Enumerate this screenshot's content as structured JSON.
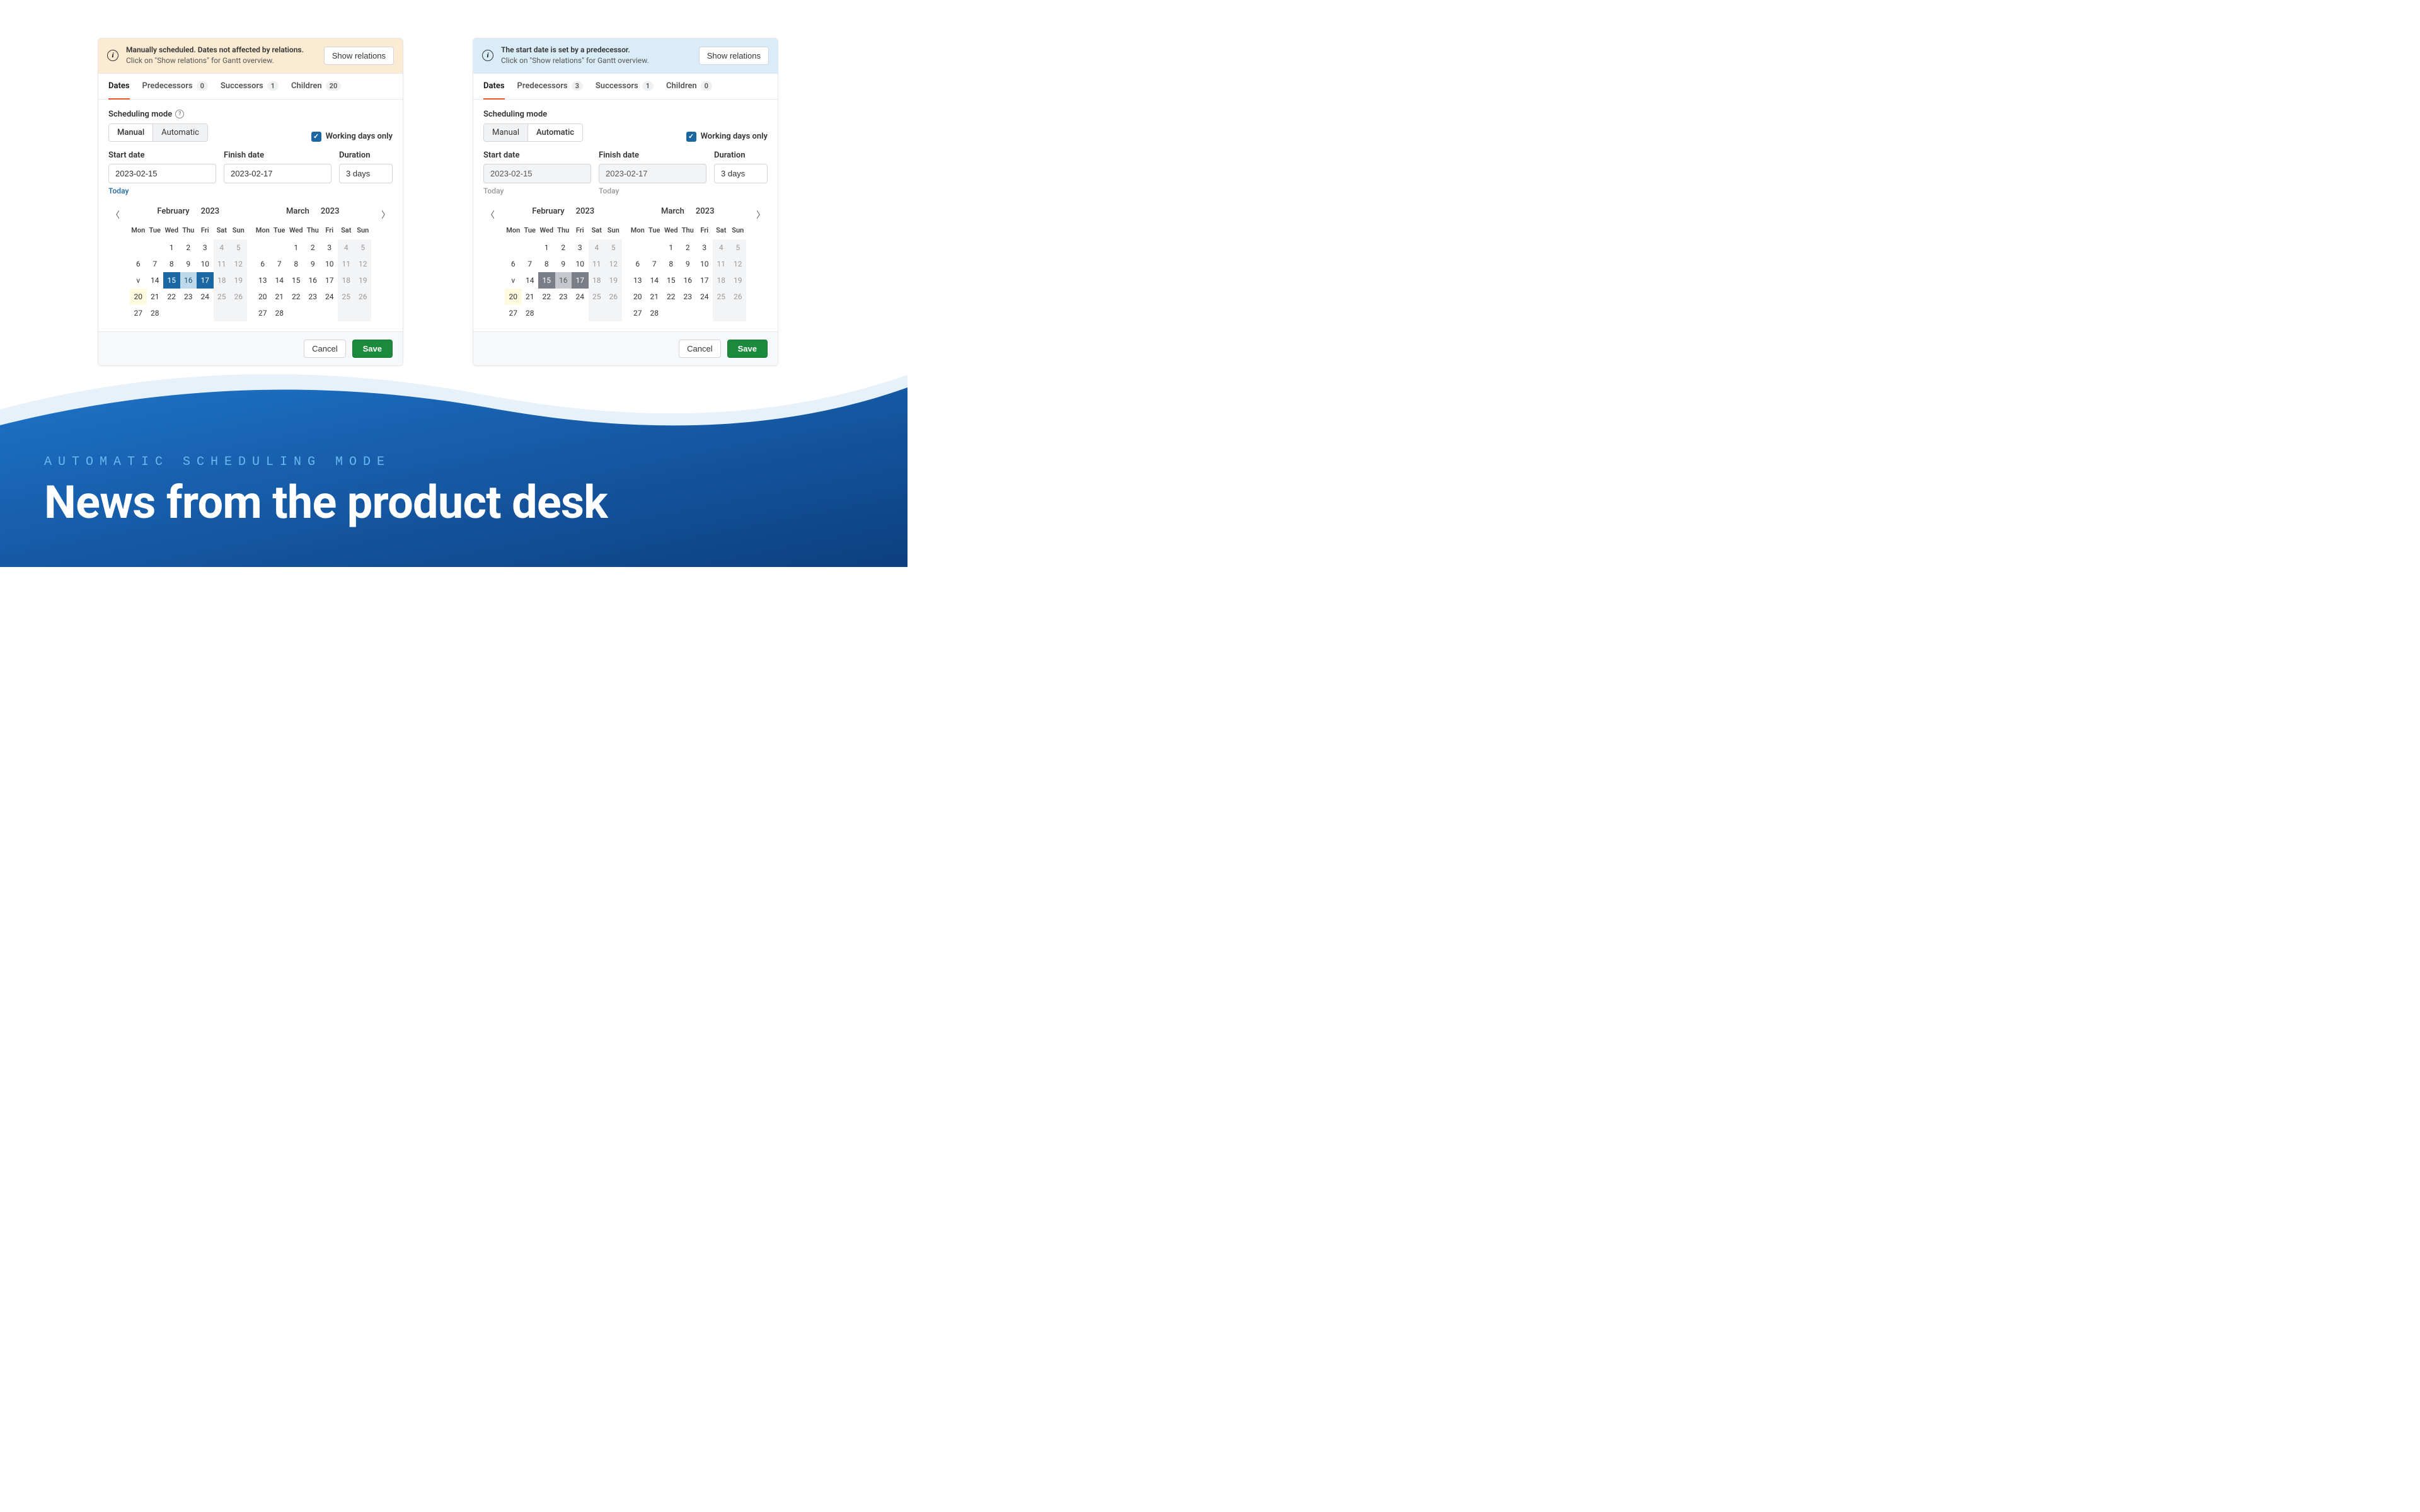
{
  "panel_manual": {
    "banner": {
      "title": "Manually scheduled. Dates not affected by relations.",
      "sub": "Click on \"Show relations\" for Gantt overview.",
      "button": "Show relations"
    },
    "tabs": [
      {
        "label": "Dates",
        "active": true
      },
      {
        "label": "Predecessors",
        "count": "0"
      },
      {
        "label": "Successors",
        "count": "1"
      },
      {
        "label": "Children",
        "count": "20"
      }
    ],
    "scheduling_label": "Scheduling mode",
    "mode_manual": "Manual",
    "mode_auto": "Automatic",
    "mode_active": "manual",
    "working_days": "Working days only",
    "start_label": "Start date",
    "finish_label": "Finish date",
    "duration_label": "Duration",
    "start_value": "2023-02-15",
    "finish_value": "2023-02-17",
    "duration_value": "3 days",
    "today": "Today",
    "cal_left": {
      "month": "February",
      "year": "2023"
    },
    "cal_right": {
      "month": "March",
      "year": "2023"
    },
    "cancel": "Cancel",
    "save": "Save"
  },
  "panel_auto": {
    "banner": {
      "title": "The start date is set by a predecessor.",
      "sub": "Click on \"Show relations\" for Gantt overview.",
      "button": "Show relations"
    },
    "tabs": [
      {
        "label": "Dates",
        "active": true
      },
      {
        "label": "Predecessors",
        "count": "3"
      },
      {
        "label": "Successors",
        "count": "1"
      },
      {
        "label": "Children",
        "count": "0"
      }
    ],
    "scheduling_label": "Scheduling mode",
    "mode_manual": "Manual",
    "mode_auto": "Automatic",
    "mode_active": "auto",
    "working_days": "Working days only",
    "start_label": "Start date",
    "finish_label": "Finish date",
    "duration_label": "Duration",
    "start_value": "2023-02-15",
    "finish_value": "2023-02-17",
    "duration_value": "3 days",
    "today": "Today",
    "cal_left": {
      "month": "February",
      "year": "2023"
    },
    "cal_right": {
      "month": "March",
      "year": "2023"
    },
    "cancel": "Cancel",
    "save": "Save"
  },
  "dows": [
    "Mon",
    "Tue",
    "Wed",
    "Thu",
    "Fri",
    "Sat",
    "Sun"
  ],
  "feb": {
    "weeks": [
      [
        "",
        "",
        "1",
        "2",
        "3",
        "4",
        "5"
      ],
      [
        "6",
        "7",
        "8",
        "9",
        "10",
        "11",
        "12"
      ],
      [
        "v",
        "14",
        "15",
        "16",
        "17",
        "18",
        "19"
      ],
      [
        "20",
        "21",
        "22",
        "23",
        "24",
        "25",
        "26"
      ],
      [
        "27",
        "28",
        "",
        "",
        "",
        "",
        ""
      ]
    ],
    "selected": [
      "15",
      "16",
      "17"
    ],
    "today": "20"
  },
  "mar": {
    "weeks": [
      [
        "",
        "",
        "1",
        "2",
        "3",
        "4",
        "5"
      ],
      [
        "6",
        "7",
        "8",
        "9",
        "10",
        "11",
        "12"
      ],
      [
        "13",
        "14",
        "15",
        "16",
        "17",
        "18",
        "19"
      ],
      [
        "20",
        "21",
        "22",
        "23",
        "24",
        "25",
        "26"
      ],
      [
        "27",
        "28",
        "",
        "",
        "",
        "",
        ""
      ]
    ]
  },
  "hero": {
    "eyebrow": "AUTOMATIC SCHEDULING MODE",
    "title": "News from the product desk"
  }
}
